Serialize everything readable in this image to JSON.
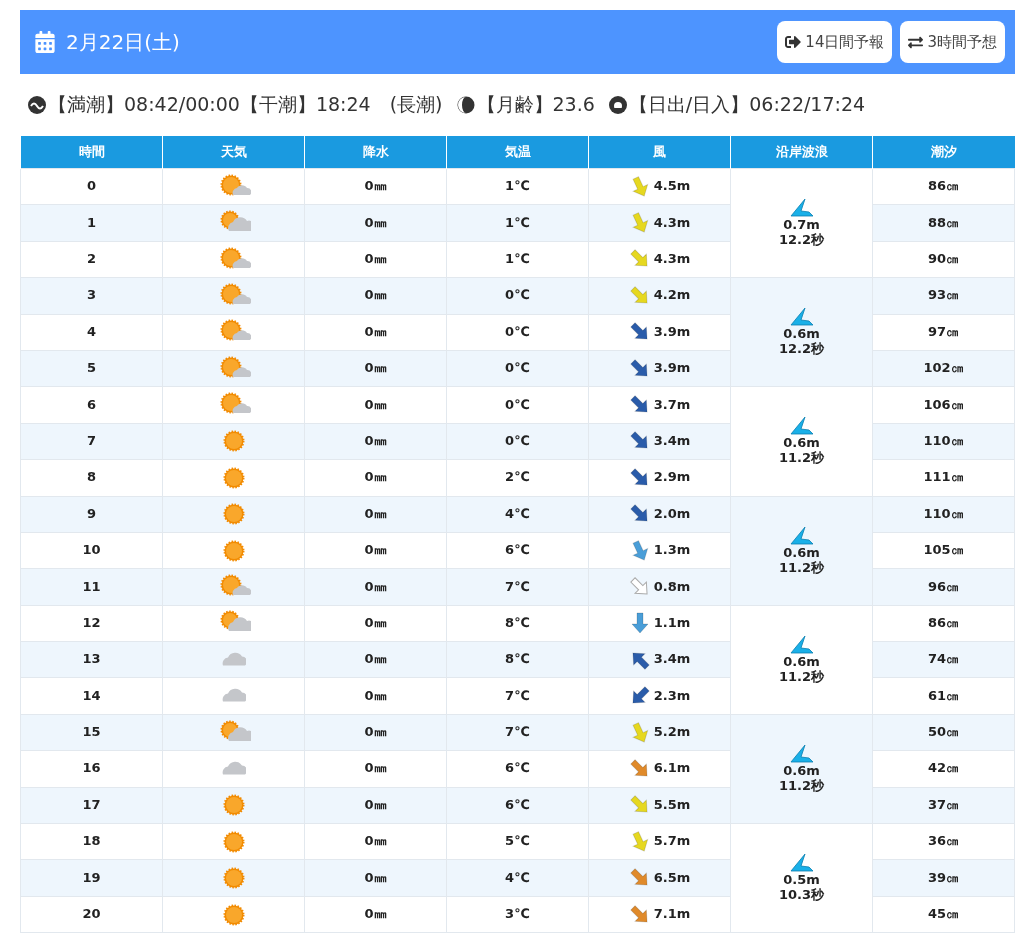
{
  "header": {
    "date": "2月22日(土)",
    "buttons": [
      {
        "kind": "forecast14",
        "label": "14日間予報"
      },
      {
        "kind": "hourly3",
        "label": "3時間予想"
      }
    ]
  },
  "info": {
    "tide": "【満潮】08:42/00:00【干潮】18:24　(長潮)",
    "moon": "【月齢】23.6",
    "sun": "【日出/日入】06:22/17:24"
  },
  "table": {
    "columns": [
      "時間",
      "天気",
      "降水",
      "気温",
      "風",
      "沿岸波浪",
      "潮汐"
    ],
    "rows": [
      {
        "hour": "0",
        "weather": {
          "kind": "partly"
        },
        "rain": "0㎜",
        "temp": "1℃",
        "wind": {
          "kind": "SSE",
          "color": "#e6d820",
          "speed": "4.5m"
        },
        "tide": "86㎝"
      },
      {
        "hour": "1",
        "weather": {
          "kind": "mostly_cloudy"
        },
        "rain": "0㎜",
        "temp": "1℃",
        "wind": {
          "kind": "SSE",
          "color": "#e6d820",
          "speed": "4.3m"
        },
        "tide": "88㎝"
      },
      {
        "hour": "2",
        "weather": {
          "kind": "partly"
        },
        "rain": "0㎜",
        "temp": "1℃",
        "wind": {
          "kind": "SE",
          "color": "#e6d820",
          "speed": "4.3m"
        },
        "tide": "90㎝"
      },
      {
        "hour": "3",
        "weather": {
          "kind": "partly"
        },
        "rain": "0㎜",
        "temp": "0℃",
        "wind": {
          "kind": "SE",
          "color": "#e6d820",
          "speed": "4.2m"
        },
        "tide": "93㎝"
      },
      {
        "hour": "4",
        "weather": {
          "kind": "partly"
        },
        "rain": "0㎜",
        "temp": "0℃",
        "wind": {
          "kind": "SE",
          "color": "#2a5caa",
          "speed": "3.9m"
        },
        "tide": "97㎝"
      },
      {
        "hour": "5",
        "weather": {
          "kind": "partly"
        },
        "rain": "0㎜",
        "temp": "0℃",
        "wind": {
          "kind": "SE",
          "color": "#2a5caa",
          "speed": "3.9m"
        },
        "tide": "102㎝"
      },
      {
        "hour": "6",
        "weather": {
          "kind": "partly"
        },
        "rain": "0㎜",
        "temp": "0℃",
        "wind": {
          "kind": "SE",
          "color": "#2a5caa",
          "speed": "3.7m"
        },
        "tide": "106㎝"
      },
      {
        "hour": "7",
        "weather": {
          "kind": "sunny"
        },
        "rain": "0㎜",
        "temp": "0℃",
        "wind": {
          "kind": "SE",
          "color": "#2a5caa",
          "speed": "3.4m"
        },
        "tide": "110㎝"
      },
      {
        "hour": "8",
        "weather": {
          "kind": "sunny"
        },
        "rain": "0㎜",
        "temp": "2℃",
        "wind": {
          "kind": "SE",
          "color": "#2a5caa",
          "speed": "2.9m"
        },
        "tide": "111㎝"
      },
      {
        "hour": "9",
        "weather": {
          "kind": "sunny"
        },
        "rain": "0㎜",
        "temp": "4℃",
        "wind": {
          "kind": "SE",
          "color": "#2a5caa",
          "speed": "2.0m"
        },
        "tide": "110㎝"
      },
      {
        "hour": "10",
        "weather": {
          "kind": "sunny"
        },
        "rain": "0㎜",
        "temp": "6℃",
        "wind": {
          "kind": "SSE",
          "color": "#4a9ed8",
          "speed": "1.3m"
        },
        "tide": "105㎝"
      },
      {
        "hour": "11",
        "weather": {
          "kind": "partly"
        },
        "rain": "0㎜",
        "temp": "7℃",
        "wind": {
          "kind": "SE",
          "color": "#ffffff",
          "speed": "0.8m"
        },
        "tide": "96㎝"
      },
      {
        "hour": "12",
        "weather": {
          "kind": "mostly_cloudy"
        },
        "rain": "0㎜",
        "temp": "8℃",
        "wind": {
          "kind": "S",
          "color": "#4a9ed8",
          "speed": "1.1m"
        },
        "tide": "86㎝"
      },
      {
        "hour": "13",
        "weather": {
          "kind": "cloudy"
        },
        "rain": "0㎜",
        "temp": "8℃",
        "wind": {
          "kind": "NW",
          "color": "#2a5caa",
          "speed": "3.4m"
        },
        "tide": "74㎝"
      },
      {
        "hour": "14",
        "weather": {
          "kind": "cloudy"
        },
        "rain": "0㎜",
        "temp": "7℃",
        "wind": {
          "kind": "SW",
          "color": "#2a5caa",
          "speed": "2.3m"
        },
        "tide": "61㎝"
      },
      {
        "hour": "15",
        "weather": {
          "kind": "mostly_cloudy"
        },
        "rain": "0㎜",
        "temp": "7℃",
        "wind": {
          "kind": "SSE",
          "color": "#e6d820",
          "speed": "5.2m"
        },
        "tide": "50㎝"
      },
      {
        "hour": "16",
        "weather": {
          "kind": "cloudy"
        },
        "rain": "0㎜",
        "temp": "6℃",
        "wind": {
          "kind": "SE",
          "color": "#e08a2a",
          "speed": "6.1m"
        },
        "tide": "42㎝"
      },
      {
        "hour": "17",
        "weather": {
          "kind": "sunny"
        },
        "rain": "0㎜",
        "temp": "6℃",
        "wind": {
          "kind": "SE",
          "color": "#e6d820",
          "speed": "5.5m"
        },
        "tide": "37㎝"
      },
      {
        "hour": "18",
        "weather": {
          "kind": "sunny"
        },
        "rain": "0㎜",
        "temp": "5℃",
        "wind": {
          "kind": "SSE",
          "color": "#e6d820",
          "speed": "5.7m"
        },
        "tide": "36㎝"
      },
      {
        "hour": "19",
        "weather": {
          "kind": "sunny"
        },
        "rain": "0㎜",
        "temp": "4℃",
        "wind": {
          "kind": "SE",
          "color": "#e08a2a",
          "speed": "6.5m"
        },
        "tide": "39㎝"
      },
      {
        "hour": "20",
        "weather": {
          "kind": "sunny"
        },
        "rain": "0㎜",
        "temp": "3℃",
        "wind": {
          "kind": "SE",
          "color": "#e08a2a",
          "speed": "7.1m"
        },
        "tide": "45㎝"
      }
    ],
    "waves": [
      {
        "height": "0.7m",
        "period": "12.2秒"
      },
      {
        "height": "0.6m",
        "period": "12.2秒"
      },
      {
        "height": "0.6m",
        "period": "11.2秒"
      },
      {
        "height": "0.6m",
        "period": "11.2秒"
      },
      {
        "height": "0.6m",
        "period": "11.2秒"
      },
      {
        "height": "0.6m",
        "period": "11.2秒"
      },
      {
        "height": "0.5m",
        "period": "10.3秒"
      }
    ]
  }
}
